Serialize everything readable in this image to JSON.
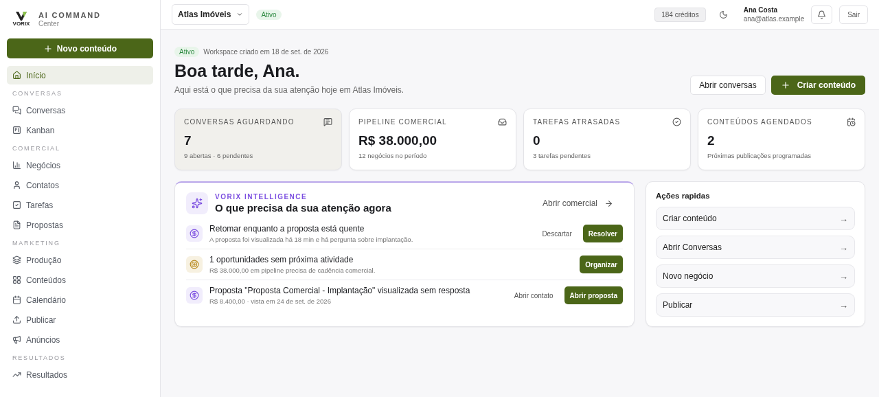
{
  "brand": {
    "logo": "VORIX",
    "title": "AI COMMAND",
    "subtitle": "Center"
  },
  "new_button": "Novo conteúdo",
  "nav": [
    {
      "items": [
        {
          "label": "Início",
          "selected": true
        }
      ]
    },
    {
      "heading": "CONVERSAS",
      "items": [
        {
          "label": "Conversas",
          "selected": false
        },
        {
          "label": "Kanban",
          "selected": false
        }
      ]
    },
    {
      "heading": "COMERCIAL",
      "items": [
        {
          "label": "Negócios",
          "selected": false
        },
        {
          "label": "Contatos",
          "selected": false
        },
        {
          "label": "Tarefas",
          "selected": false
        },
        {
          "label": "Propostas",
          "selected": false
        }
      ]
    },
    {
      "heading": "MARKETING",
      "items": [
        {
          "label": "Produção",
          "selected": false
        },
        {
          "label": "Conteúdos",
          "selected": false
        },
        {
          "label": "Calendário",
          "selected": false
        },
        {
          "label": "Publicar",
          "selected": false
        },
        {
          "label": "Anúncios",
          "selected": false
        }
      ]
    },
    {
      "heading": "RESULTADOS",
      "items": [
        {
          "label": "Resultados",
          "selected": false
        }
      ]
    }
  ],
  "topbar": {
    "workspace": "Atlas Imóveis",
    "status": "Ativo",
    "credits": "184 créditos",
    "user_name": "Ana Costa",
    "user_email": "ana@atlas.example",
    "logout": "Sair"
  },
  "hero": {
    "badge": "Ativo",
    "meta": "Workspace criado em 18 de set. de 2026",
    "title": "Boa tarde, Ana.",
    "subtitle": "Aqui está o que precisa da sua atenção hoje em Atlas Imóveis.",
    "secondary_button": "Abrir conversas",
    "primary_button": "Criar conteúdo"
  },
  "stats": [
    {
      "label": "CONVERSAS AGUARDANDO",
      "value": "7",
      "note": "9 abertas · 6 pendentes",
      "selected": true
    },
    {
      "label": "PIPELINE COMERCIAL",
      "value": "R$ 38.000,00",
      "note": "12 negócios no período",
      "selected": false
    },
    {
      "label": "TAREFAS ATRASADAS",
      "value": "0",
      "note": "3 tarefas pendentes",
      "selected": false
    },
    {
      "label": "CONTEÚDOS AGENDADOS",
      "value": "2",
      "note": "Próximas publicações programadas",
      "selected": false
    }
  ],
  "intelligence": {
    "eyebrow": "VORIX INTELLIGENCE",
    "title": "O que precisa da sua atenção agora",
    "link": "Abrir comercial",
    "items": [
      {
        "kind": "money",
        "title": "Retomar enquanto a proposta está quente",
        "detail": "A proposta foi visualizada há 18 min e há pergunta sobre implantação.",
        "secondary": "Descartar",
        "primary": "Resolver"
      },
      {
        "kind": "target",
        "title": "1 oportunidades sem próxima atividade",
        "detail": "R$ 38.000,00 em pipeline precisa de cadência comercial.",
        "primary": "Organizar"
      },
      {
        "kind": "money",
        "title": "Proposta \"Proposta Comercial - Implantação\" visualizada sem resposta",
        "detail": "R$ 8.400,00 · vista em 24 de set. de 2026",
        "secondary": "Abrir contato",
        "primary": "Abrir proposta"
      }
    ]
  },
  "quick_actions": {
    "title": "Ações rapidas",
    "items": [
      {
        "label": "Criar conteúdo",
        "arrow": "→"
      },
      {
        "label": "Abrir Conversas",
        "arrow": "→"
      },
      {
        "label": "Novo negócio",
        "arrow": "→"
      },
      {
        "label": "Publicar",
        "arrow": "→"
      }
    ]
  }
}
